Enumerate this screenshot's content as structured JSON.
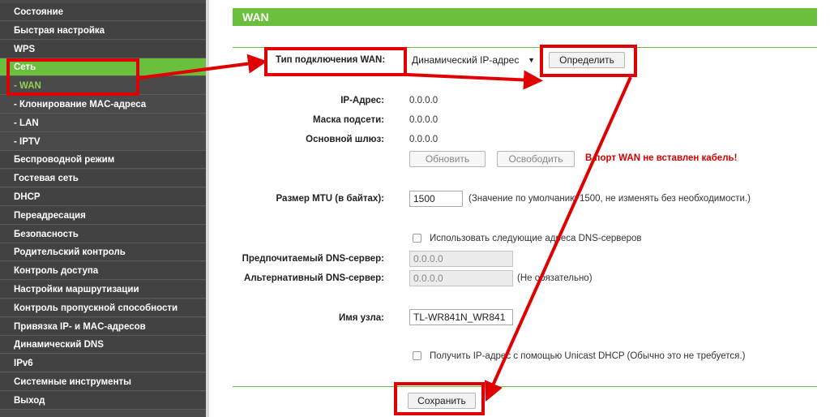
{
  "sidebar": {
    "items": [
      {
        "label": "Состояние",
        "type": "main"
      },
      {
        "label": "Быстрая настройка",
        "type": "main"
      },
      {
        "label": "WPS",
        "type": "main"
      },
      {
        "label": "Сеть",
        "type": "active"
      },
      {
        "label": "- WAN",
        "type": "subactive"
      },
      {
        "label": "- Клонирование MAC-адреса",
        "type": "sub"
      },
      {
        "label": "- LAN",
        "type": "sub"
      },
      {
        "label": "- IPTV",
        "type": "sub"
      },
      {
        "label": "Беспроводной режим",
        "type": "main"
      },
      {
        "label": "Гостевая сеть",
        "type": "main"
      },
      {
        "label": "DHCP",
        "type": "main"
      },
      {
        "label": "Переадресация",
        "type": "main"
      },
      {
        "label": "Безопасность",
        "type": "main"
      },
      {
        "label": "Родительский контроль",
        "type": "main"
      },
      {
        "label": "Контроль доступа",
        "type": "main"
      },
      {
        "label": "Настройки маршрутизации",
        "type": "main"
      },
      {
        "label": "Контроль пропускной способности",
        "type": "main"
      },
      {
        "label": "Привязка IP- и MAC-адресов",
        "type": "main"
      },
      {
        "label": "Динамический DNS",
        "type": "main"
      },
      {
        "label": "IPv6",
        "type": "main"
      },
      {
        "label": "Системные инструменты",
        "type": "main"
      },
      {
        "label": "Выход",
        "type": "main"
      }
    ]
  },
  "header": {
    "title": "WAN"
  },
  "form": {
    "conn_type_label": "Тип подключения WAN:",
    "conn_type_value": "Динамический IP-адрес",
    "detect_button": "Определить",
    "ip_label": "IP-Адрес:",
    "ip_value": "0.0.0.0",
    "mask_label": "Маска подсети:",
    "mask_value": "0.0.0.0",
    "gateway_label": "Основной шлюз:",
    "gateway_value": "0.0.0.0",
    "renew_button": "Обновить",
    "release_button": "Освободить",
    "cable_warning": "В порт WAN не вставлен кабель!",
    "mtu_label": "Размер MTU (в байтах):",
    "mtu_value": "1500",
    "mtu_note": "(Значение по умолчанию 1500, не изменять без необходимости.)",
    "dns_checkbox_label": "Использовать следующие адреса DNS-серверов",
    "dns_primary_label": "Предпочитаемый DNS-сервер:",
    "dns_primary_value": "0.0.0.0",
    "dns_secondary_label": "Альтернативный DNS-сервер:",
    "dns_secondary_value": "0.0.0.0",
    "dns_secondary_note": "(Не обязательно)",
    "hostname_label": "Имя узла:",
    "hostname_value": "TL-WR841N_WR841",
    "unicast_label": "Получить IP-адрес с помощью Unicast DHCP (Обычно это не требуется.)",
    "save_button": "Сохранить"
  },
  "colors": {
    "accent": "#6abf3d",
    "annotation": "#e00000",
    "sidebar_bg": "#424242"
  }
}
